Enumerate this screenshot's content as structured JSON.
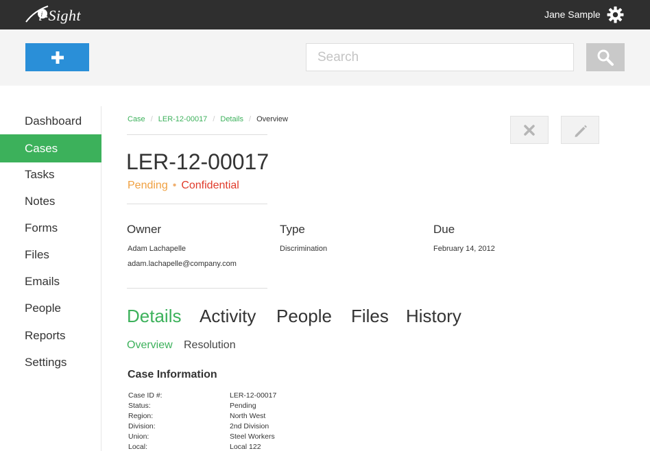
{
  "app": {
    "logo_text": "i-Sight",
    "user_name": "Jane Sample",
    "icons": {
      "settings": "gear-icon",
      "add": "plus-icon",
      "search": "magnifier-icon",
      "close": "x-icon",
      "edit": "pencil-icon"
    }
  },
  "toolbar": {
    "search_placeholder": "Search"
  },
  "sidebar": {
    "items": [
      {
        "label": "Dashboard",
        "active": false
      },
      {
        "label": "Cases",
        "active": true
      },
      {
        "label": "Tasks",
        "active": false
      },
      {
        "label": "Notes",
        "active": false
      },
      {
        "label": "Forms",
        "active": false
      },
      {
        "label": "Files",
        "active": false
      },
      {
        "label": "Emails",
        "active": false
      },
      {
        "label": "People",
        "active": false
      },
      {
        "label": "Reports",
        "active": false
      },
      {
        "label": "Settings",
        "active": false
      }
    ]
  },
  "breadcrumb": {
    "items": [
      "Case",
      "LER-12-00017",
      "Details"
    ],
    "current": "Overview"
  },
  "case": {
    "title": "LER-12-00017",
    "status": "Pending",
    "status_separator": "•",
    "classification": "Confidential"
  },
  "meta": {
    "owner_label": "Owner",
    "owner_name": "Adam Lachapelle",
    "owner_email": "adam.lachapelle@company.com",
    "type_label": "Type",
    "type_value": "Discrimination",
    "due_label": "Due",
    "due_value": "February 14, 2012"
  },
  "tabs": [
    {
      "label": "Details",
      "active": true
    },
    {
      "label": "Activity",
      "active": false
    },
    {
      "label": "People",
      "active": false
    },
    {
      "label": "Files",
      "active": false
    },
    {
      "label": "History",
      "active": false
    }
  ],
  "subtabs": [
    {
      "label": "Overview",
      "active": true
    },
    {
      "label": "Resolution",
      "active": false
    }
  ],
  "case_information": {
    "title": "Case Information",
    "rows": [
      {
        "key": "Case ID #:",
        "value": "LER-12-00017"
      },
      {
        "key": "Status:",
        "value": "Pending"
      },
      {
        "key": "Region:",
        "value": "North West"
      },
      {
        "key": "Division:",
        "value": "2nd Division"
      },
      {
        "key": "Union:",
        "value": "Steel Workers"
      },
      {
        "key": "Local:",
        "value": "Local 122"
      }
    ]
  },
  "colors": {
    "accent_green": "#3cb15b",
    "add_button_blue": "#2a8fd8",
    "pending_orange": "#f0a040",
    "confidential_red": "#e03a2a",
    "topbar": "#2f2f2f"
  }
}
